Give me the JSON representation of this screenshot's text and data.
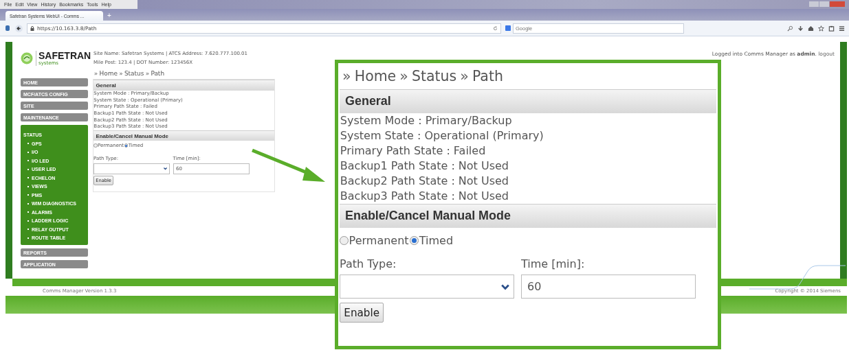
{
  "browser": {
    "menu": [
      "File",
      "Edit",
      "View",
      "History",
      "Bookmarks",
      "Tools",
      "Help"
    ],
    "tab": {
      "title": "Safetran Systems WebUI - Comms ...",
      "new_tab": "+"
    },
    "address": "https://10.163.3.8/Path",
    "search": {
      "placeholder": "Google"
    }
  },
  "header": {
    "logo": {
      "name": "SAFETRAN",
      "sub": "systems"
    },
    "info": [
      "Site Name: Safetran Systems | ATCS Address: 7.620.777.100.01",
      "Mile Post: 123.4 | DOT Number: 123456X"
    ],
    "login": {
      "text": "Logged into Comms Manager as **admin**.",
      "link": "logout"
    }
  },
  "sidebar": {
    "items": [
      {
        "label": "HOME",
        "selected": false
      },
      {
        "label": "MCF/ATCS CONFIG",
        "selected": false
      },
      {
        "label": "SITE",
        "selected": false
      },
      {
        "label": "MAINTENANCE",
        "selected": false
      },
      {
        "label": "STATUS",
        "selected": true,
        "children": [
          "GPS",
          "I/O",
          "I/O LED",
          "USER LED",
          "ECHELON",
          "VIEWS",
          "PMS",
          "WIM DIAGNOSTICS",
          "ALARMS",
          "LADDER LOGIC",
          "RELAY OUTPUT",
          "ROUTE TABLE"
        ]
      },
      {
        "label": "REPORTS",
        "selected": false
      },
      {
        "label": "APPLICATION",
        "selected": false
      }
    ]
  },
  "content": {
    "breadcrumb_separator": "»",
    "breadcrumb": [
      "Home",
      "Status",
      "Path"
    ],
    "general_title": "General",
    "lines": [
      "System Mode : Primary/Backup",
      "System State : Operational (Primary)",
      "Primary Path State : Failed",
      "Backup1 Path State : Not Used",
      "Backup2 Path State : Not Used",
      "Backup3 Path State : Not Used"
    ],
    "manual_title": "Enable/Cancel Manual Mode",
    "options": [
      {
        "label": "Permanent",
        "selected": false
      },
      {
        "label": "Timed",
        "selected": true
      }
    ],
    "path_label": "Path Type:",
    "time_label": "Time [min]:",
    "time_value": "60",
    "button": "Enable"
  },
  "callout": {
    "breadcrumb_separator": "»",
    "breadcrumb": [
      "Home",
      "Status",
      "Path"
    ],
    "general_title": "General",
    "lines": [
      "System Mode : Primary/Backup",
      "System State : Operational (Primary)",
      "Primary Path State : Failed",
      "Backup1 Path State : Not Used",
      "Backup2 Path State : Not Used",
      "Backup3 Path State : Not Used"
    ],
    "manual_title": "Enable/Cancel Manual Mode",
    "options": [
      {
        "label": "Permanent",
        "selected": false
      },
      {
        "label": "Timed",
        "selected": true
      }
    ],
    "path_label": "Path Type:",
    "time_label": "Time [min]:",
    "time_value": "60",
    "button": "Enable"
  },
  "footer": {
    "version": "Comms Manager Version 1.3.3",
    "copyright": "Copyright © 2014 Siemens"
  }
}
